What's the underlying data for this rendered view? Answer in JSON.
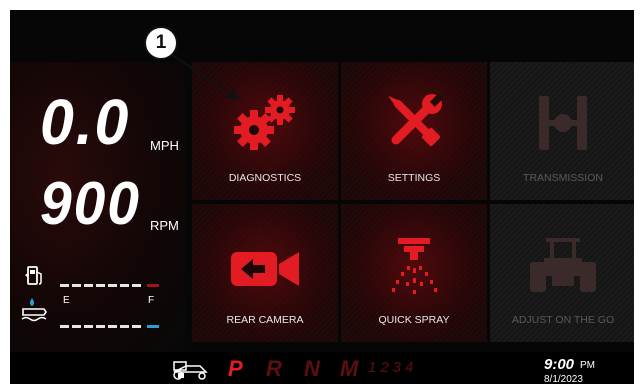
{
  "callout": {
    "number": "1"
  },
  "speed": {
    "value": "0.0",
    "unit": "MPH"
  },
  "engine": {
    "value": "900",
    "unit": "RPM"
  },
  "fuel_gauge": {
    "level": 0.88
  },
  "def_gauge": {
    "empty_label": "E",
    "full_label": "F",
    "level": 1.0
  },
  "tiles": [
    {
      "label": "DIAGNOSTICS",
      "icon": "gears-icon",
      "enabled": true
    },
    {
      "label": "SETTINGS",
      "icon": "wrench-screwdriver-icon",
      "enabled": true
    },
    {
      "label": "TRANSMISSION",
      "icon": "transmission-icon",
      "enabled": false
    },
    {
      "label": "REAR CAMERA",
      "icon": "camera-icon",
      "enabled": true
    },
    {
      "label": "QUICK SPRAY",
      "icon": "sprayer-icon",
      "enabled": true
    },
    {
      "label": "ADJUST ON THE GO",
      "icon": "tractor-icon",
      "enabled": false
    }
  ],
  "status_bar": {
    "gears": [
      "P",
      "R",
      "N",
      "M"
    ],
    "active_gear": "P",
    "gear_numbers": "1234",
    "time": "9:00",
    "ampm": "PM",
    "date": "8/1/2023"
  },
  "colors": {
    "accent_red": "#e31b23",
    "def_blue": "#2a9fd6",
    "dim_red": "#5c0f12"
  }
}
